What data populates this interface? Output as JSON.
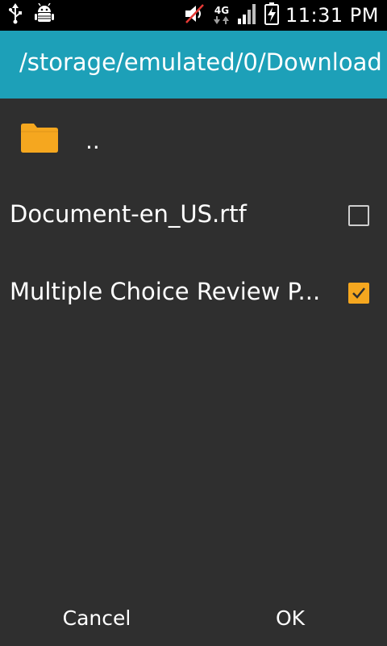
{
  "status_bar": {
    "time": "11:31 PM",
    "network_type": "4G",
    "icons": [
      "usb-icon",
      "android-debug-icon",
      "volume-muted-icon",
      "network-4g-icon",
      "signal-icon",
      "battery-charging-icon"
    ]
  },
  "header": {
    "path": "/storage/emulated/0/Download"
  },
  "list": {
    "parent_label": "..",
    "files": [
      {
        "name": "Document-en_US.rtf",
        "checked": false
      },
      {
        "name": "Multiple Choice Review P...",
        "checked": true
      }
    ]
  },
  "footer": {
    "cancel_label": "Cancel",
    "ok_label": "OK"
  },
  "colors": {
    "header": "#1da0b8",
    "background": "#2f2f2f",
    "accent": "#f5a71f"
  }
}
